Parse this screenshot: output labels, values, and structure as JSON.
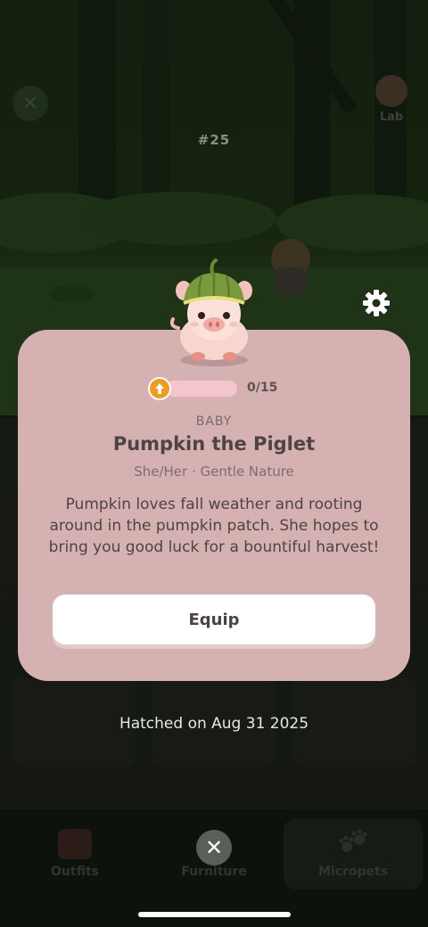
{
  "background": {
    "lab_label": "Lab",
    "pet_number": "#25",
    "close_glyph": "✕"
  },
  "pet": {
    "stage": "BABY",
    "name": "Pumpkin the Piglet",
    "meta": "She/Her · Gentle Nature",
    "description": "Pumpkin loves fall weather and rooting around in the pumpkin patch. She hopes to bring you good luck for a bountiful harvest!",
    "xp": {
      "current": 0,
      "max": 15,
      "label": "0/15"
    },
    "hatched": "Hatched on Aug 31 2025"
  },
  "actions": {
    "equip_label": "Equip",
    "dismiss_glyph": "✕"
  },
  "tabs": [
    {
      "label": "Outfits",
      "icon": "gift-icon"
    },
    {
      "label": "Furniture",
      "icon": "lamp-icon"
    },
    {
      "label": "Micropets",
      "icon": "paw-icon"
    }
  ],
  "colors": {
    "card": "#d6b1b2",
    "xp_badge": "#f29a1d",
    "xp_track": "#f4c6cc",
    "button": "#ffffff"
  }
}
